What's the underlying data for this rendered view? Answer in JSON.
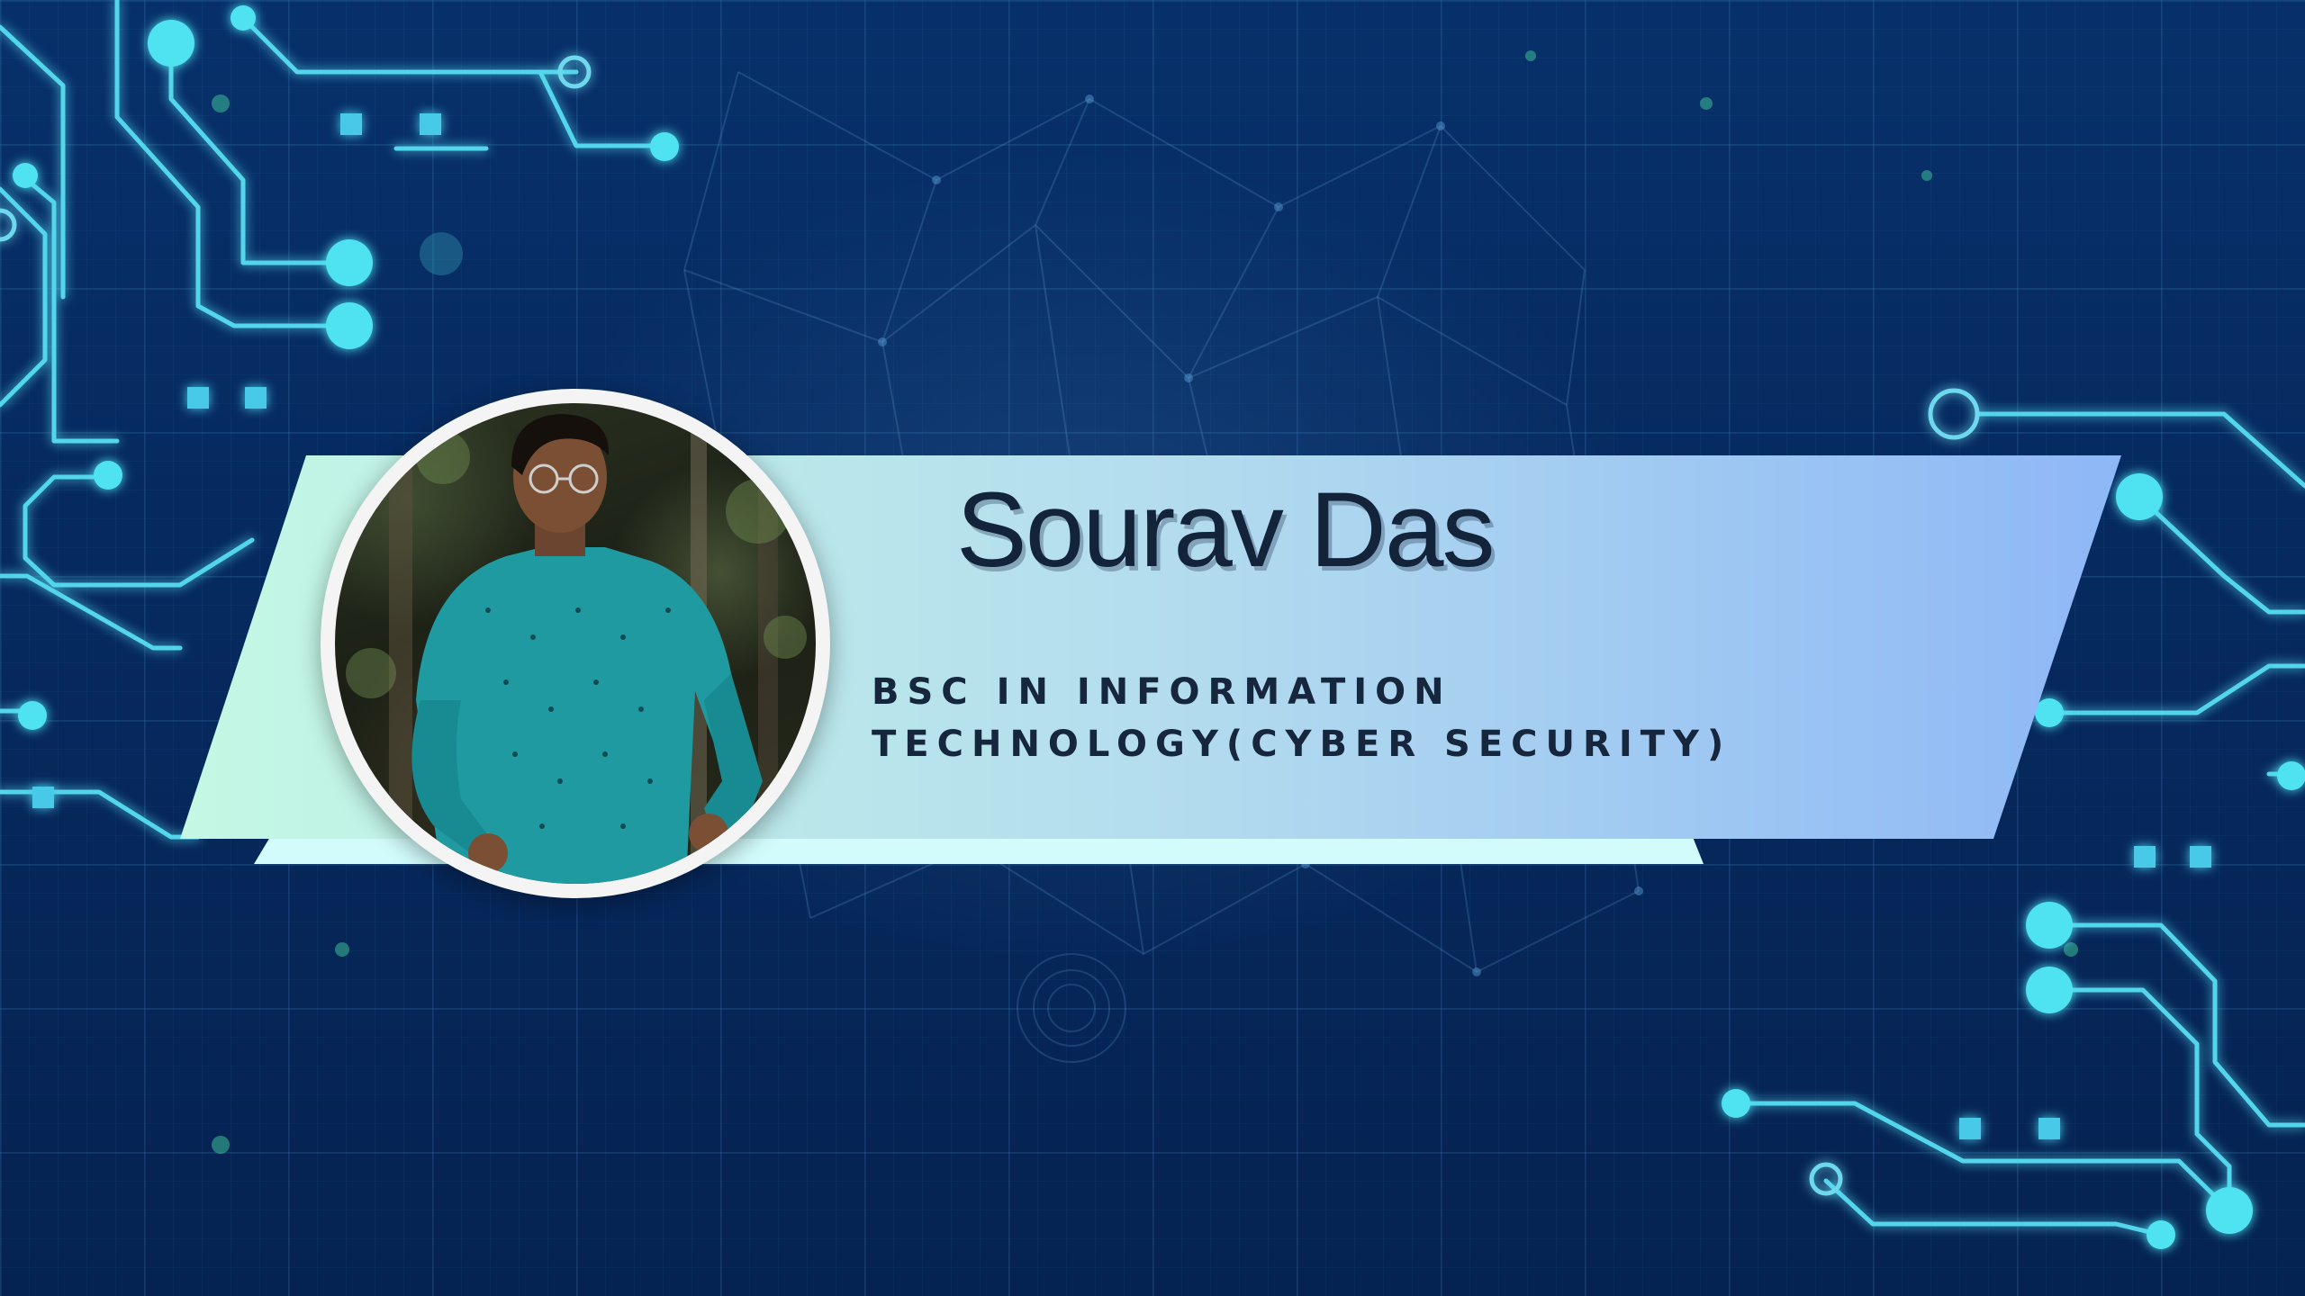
{
  "profile": {
    "name": "Sourav Das",
    "degree": "BSC IN INFORMATION TECHNOLOGY(CYBER SECURITY)"
  },
  "colors": {
    "background": "#062a5c",
    "circuit_accent": "#4fe3f2",
    "banner_gradient_start": "#c6f7e6",
    "banner_gradient_end": "#8fb8f6",
    "banner_underline": "#d2fbfb",
    "text": "#12233a",
    "photo_ring": "#f4f4f4"
  },
  "icons": [
    "circuit-trace-icon",
    "profile-photo"
  ]
}
